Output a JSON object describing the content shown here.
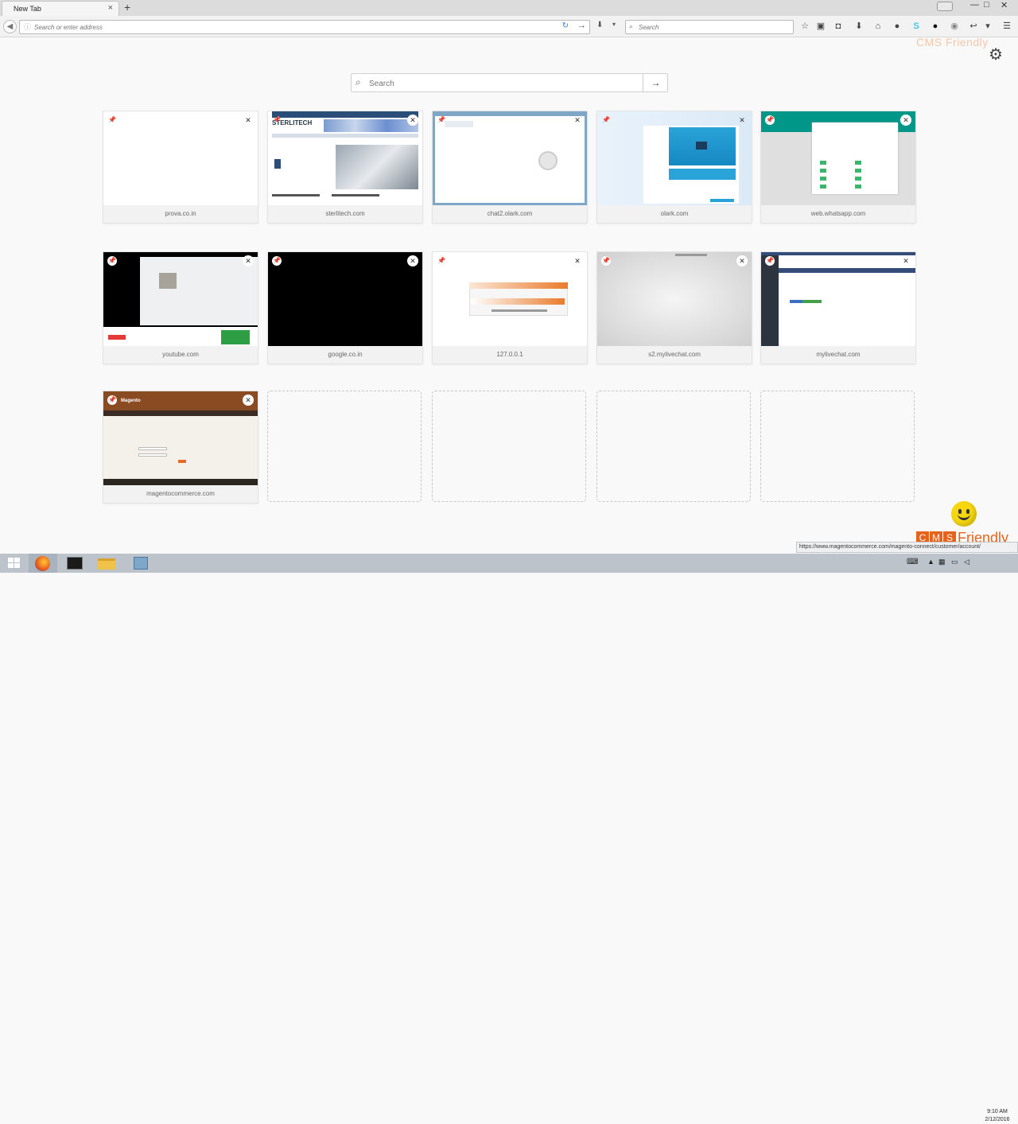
{
  "browser": {
    "tab_title": "New Tab",
    "tab_close": "×",
    "new_tab": "+",
    "url_placeholder": "Search or enter address",
    "search_placeholder": "Search",
    "window_controls": [
      "—",
      "□",
      "✕"
    ]
  },
  "newtab": {
    "search_placeholder": "Search",
    "go_glyph": "→",
    "tiles": [
      {
        "label": "prova.co.in"
      },
      {
        "label": "sterlitech.com"
      },
      {
        "label": "chat2.olark.com"
      },
      {
        "label": "olark.com"
      },
      {
        "label": "web.whatsapp.com"
      },
      {
        "label": "youtube.com"
      },
      {
        "label": "google.co.in"
      },
      {
        "label": "127.0.0.1"
      },
      {
        "label": "s2.mylivechat.com"
      },
      {
        "label": "mylivechat.com"
      },
      {
        "label": "magentocommerce.com"
      }
    ],
    "empty_slot_count": 4
  },
  "thumbs": {
    "sterlitech_brand": "STERLITECH",
    "magento_brand": "Magento"
  },
  "status_url": "https://www.magentocommerce.com/magento-connect/customer/account/",
  "clock": {
    "time": "9:10 AM",
    "date": "2/12/2016"
  },
  "watermark": {
    "c": "C",
    "m": "M",
    "s": "S",
    "rest": "Friendly",
    "top": "CMS Friendly"
  },
  "colors": {
    "whatsapp_teal": "#009688",
    "magento_brown": "#8a4a22",
    "accent_blue": "#3d7bd9"
  },
  "icons": {
    "toolbar": [
      "star-icon",
      "clipboard-icon",
      "pocket-icon",
      "download-icon",
      "home-icon",
      "chat-icon",
      "skype-icon",
      "dark-circle-icon",
      "extension-icon",
      "arrow-icon",
      "overflow-icon",
      "menu-icon"
    ]
  }
}
